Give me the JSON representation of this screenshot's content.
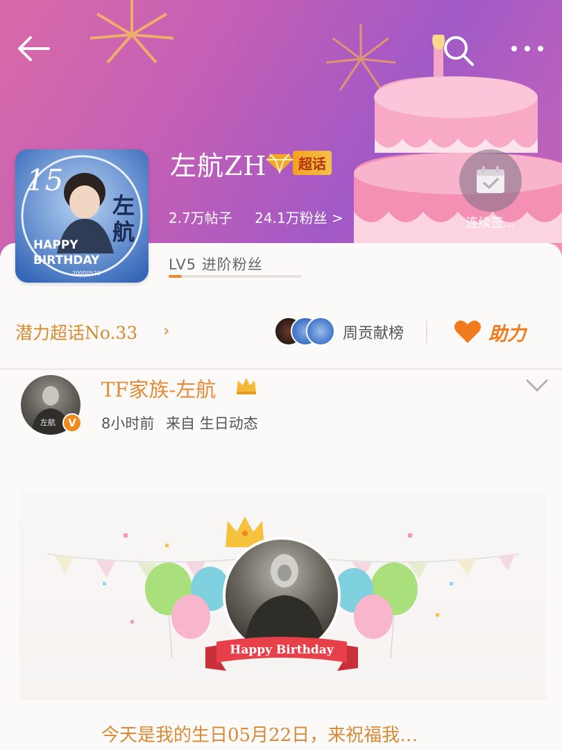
{
  "header": {
    "topic_title": "左航ZH",
    "badge_label": "超话",
    "posts_count": "2.7万帖子",
    "fans_count": "24.1万粉丝 >",
    "checkin_label": "连续签...",
    "avatar_text": {
      "big": "15",
      "name": "左航",
      "line1": "HAPPY",
      "line2": "BIRTHDAY",
      "date": "20000522"
    }
  },
  "level": {
    "label": "LV5 进阶粉丝",
    "progress": 0.1
  },
  "rank": {
    "label": "潜力超话No.33",
    "contributors_label": "周贡献榜",
    "help_label": "助力"
  },
  "post": {
    "author": "TF家族-左航",
    "time": "8小时前",
    "source": "来自 生日动态",
    "avatar_caption": "左航",
    "verify_mark": "V",
    "image_caption": "Happy Birthday",
    "text": "今天是我的生日05月22日，来祝福我…"
  },
  "colors": {
    "accent": "#f07a1c",
    "banner_start": "#d96aa8",
    "banner_end": "#a159c6",
    "name_color": "#e38a36"
  },
  "icons": [
    "back-arrow-icon",
    "search-icon",
    "more-icon",
    "diamond-icon",
    "calendar-check-icon",
    "heart-icon",
    "crown-icon",
    "chevron-down-icon"
  ]
}
